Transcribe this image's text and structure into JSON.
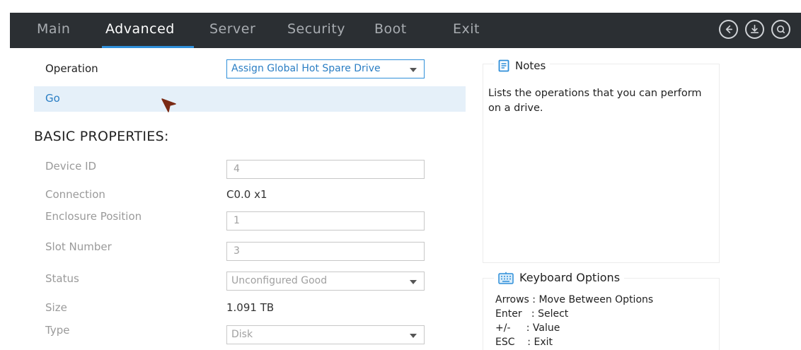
{
  "tabs": [
    {
      "label": "Main"
    },
    {
      "label": "Advanced"
    },
    {
      "label": "Server"
    },
    {
      "label": "Security"
    },
    {
      "label": "Boot"
    },
    {
      "label": "Exit"
    }
  ],
  "active_tab": "Advanced",
  "icons": [
    "back-icon",
    "download-icon",
    "search-icon"
  ],
  "operation": {
    "label": "Operation",
    "value": "Assign Global Hot Spare Drive"
  },
  "go_label": "Go",
  "section_title": "BASIC PROPERTIES:",
  "properties": {
    "device_id": {
      "label": "Device ID",
      "value": "4"
    },
    "connection": {
      "label": "Connection",
      "value": "C0.0 x1"
    },
    "enclosure_position": {
      "label": "Enclosure Position",
      "value": "1"
    },
    "slot_number": {
      "label": "Slot Number",
      "value": "3"
    },
    "status": {
      "label": "Status",
      "value": "Unconfigured Good"
    },
    "size": {
      "label": "Size",
      "value": "1.091 TB"
    },
    "type": {
      "label": "Type",
      "value": "Disk"
    }
  },
  "notes": {
    "title": "Notes",
    "text": "Lists the operations that you can perform on a drive."
  },
  "keyboard": {
    "title": "Keyboard Options",
    "lines": [
      "Arrows : Move Between Options",
      "Enter   : Select",
      "+/-     : Value",
      "ESC    : Exit"
    ]
  },
  "colors": {
    "tabbar_bg": "#2b2f33",
    "accent": "#2f8fd9",
    "go_row_bg": "#e5f0f9"
  }
}
